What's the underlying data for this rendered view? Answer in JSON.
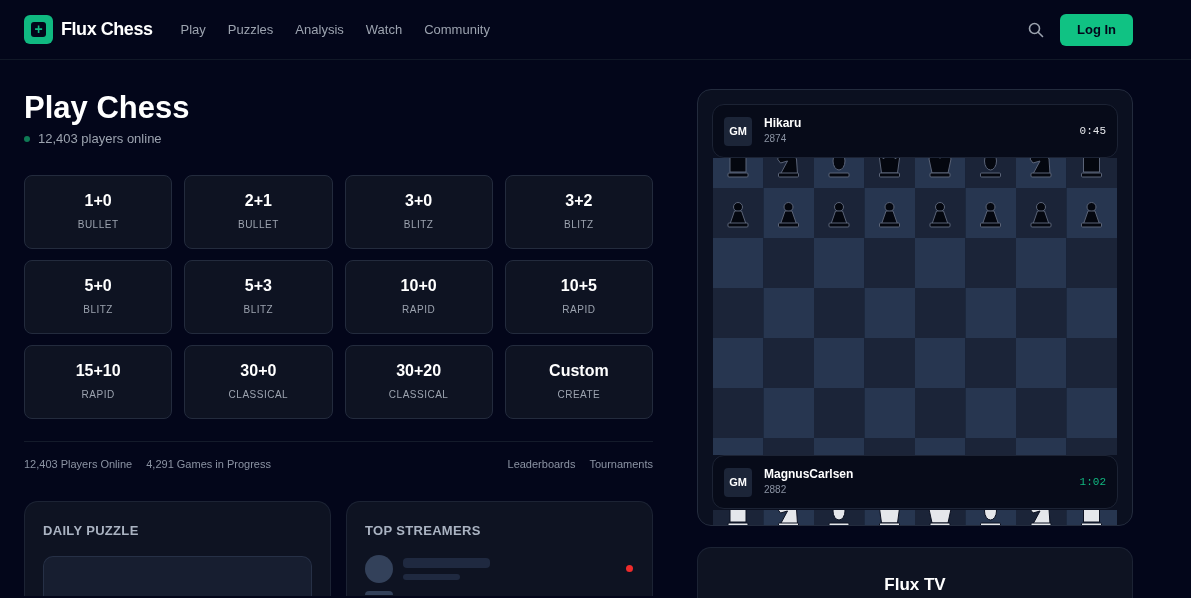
{
  "header": {
    "logo_glyph": "+",
    "brand": "Flux Chess",
    "nav": [
      {
        "label": "Play"
      },
      {
        "label": "Puzzles"
      },
      {
        "label": "Analysis"
      },
      {
        "label": "Watch"
      },
      {
        "label": "Community"
      }
    ],
    "login": "Log In"
  },
  "title": "Play Chess",
  "online": "12,403 players online",
  "time_controls": [
    {
      "time": "1+0",
      "type": "BULLET"
    },
    {
      "time": "2+1",
      "type": "BULLET"
    },
    {
      "time": "3+0",
      "type": "BLITZ"
    },
    {
      "time": "3+2",
      "type": "BLITZ"
    },
    {
      "time": "5+0",
      "type": "BLITZ"
    },
    {
      "time": "5+3",
      "type": "BLITZ"
    },
    {
      "time": "10+0",
      "type": "RAPID"
    },
    {
      "time": "10+5",
      "type": "RAPID"
    },
    {
      "time": "15+10",
      "type": "RAPID"
    },
    {
      "time": "30+0",
      "type": "CLASSICAL"
    },
    {
      "time": "30+20",
      "type": "CLASSICAL"
    },
    {
      "time": "Custom",
      "type": "CREATE"
    }
  ],
  "stats": [
    "12,403 Players Online",
    "4,291 Games in Progress"
  ],
  "links": [
    "Leaderboards",
    "Tournaments"
  ],
  "daily_puzzle": {
    "title": "DAILY PUZZLE"
  },
  "top_streamers": {
    "title": "TOP STREAMERS"
  },
  "players": [
    {
      "title": "GM",
      "name": "Hikaru",
      "rating": "2874",
      "clock": "0:45",
      "active": false
    },
    {
      "title": "GM",
      "name": "MagnusCarlsen",
      "rating": "2882",
      "clock": "1:02",
      "active": true
    }
  ],
  "flux_tv": {
    "title": "Flux TV"
  }
}
